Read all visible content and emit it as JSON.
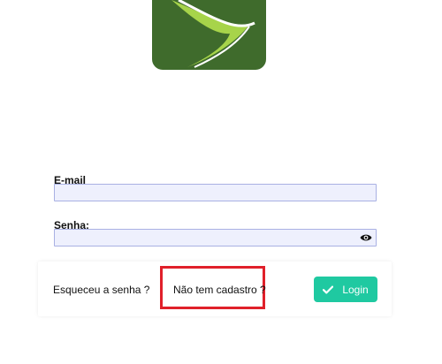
{
  "logo": {
    "icon": "boomerang-logo-icon",
    "colors": {
      "background": "#3f6b2c",
      "accent": "#a7d44a",
      "highlight": "#ffffff"
    }
  },
  "form": {
    "email": {
      "label": "E-mail",
      "value": "",
      "placeholder": ""
    },
    "password": {
      "label": "Senha:",
      "value": "",
      "placeholder": "",
      "toggle_icon": "eye-icon"
    }
  },
  "actions": {
    "forgot_label": "Esqueceu a senha ?",
    "signup_label": "Não tem cadastro ?",
    "login_label": "Login",
    "login_icon": "check-icon",
    "login_color": "#1fc9a1",
    "highlight_color": "#e0202a"
  }
}
